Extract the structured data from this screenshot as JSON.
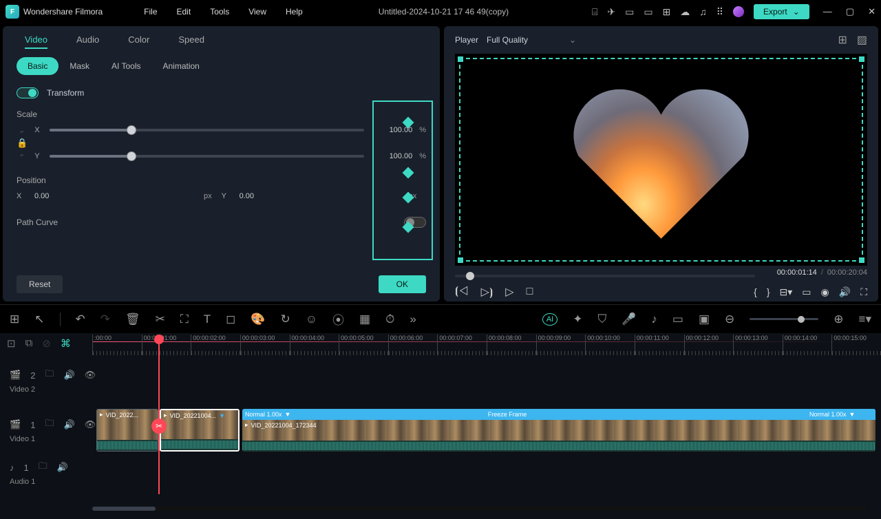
{
  "app": {
    "name": "Wondershare Filmora",
    "title": "Untitled-2024-10-21 17 46 49(copy)"
  },
  "menu": [
    "File",
    "Edit",
    "Tools",
    "View",
    "Help"
  ],
  "export_label": "Export",
  "inspector": {
    "tabs": [
      "Video",
      "Audio",
      "Color",
      "Speed"
    ],
    "subtabs": [
      "Basic",
      "Mask",
      "AI Tools",
      "Animation"
    ],
    "transform": "Transform",
    "scale": "Scale",
    "scale_x": "100.00",
    "scale_y": "100.00",
    "scale_unit": "%",
    "position": "Position",
    "pos_x": "0.00",
    "pos_y": "0.00",
    "pos_unit": "px",
    "axis_x": "X",
    "axis_y": "Y",
    "pathcurve": "Path Curve",
    "reset": "Reset",
    "ok": "OK"
  },
  "player": {
    "label": "Player",
    "quality": "Full Quality",
    "current": "00:00:01:14",
    "duration": "00:00:20:04",
    "sep": "/"
  },
  "timeline": {
    "ticks": [
      ":00:00",
      "00:00:01:00",
      "00:00:02:00",
      "00:00:03:00",
      "00:00:04:00",
      "00:00:05:00",
      "00:00:06:00",
      "00:00:07:00",
      "00:00:08:00",
      "00:00:09:00",
      "00:00:10:00",
      "00:00:11:00",
      "00:00:12:00",
      "00:00:13:00",
      "00:00:14:00",
      "00:00:15:00"
    ],
    "tracks": {
      "v2_id": "2",
      "v2_label": "Video 2",
      "v1_id": "1",
      "v1_label": "Video 1",
      "a1_id": "1",
      "a1_label": "Audio 1"
    },
    "clip_a": "VID_2022...",
    "clip_b": "VID_20221004...",
    "clip_c": "VID_20221004_172344",
    "normal": "Normal 1.00x",
    "freeze": "Freeze Frame"
  }
}
